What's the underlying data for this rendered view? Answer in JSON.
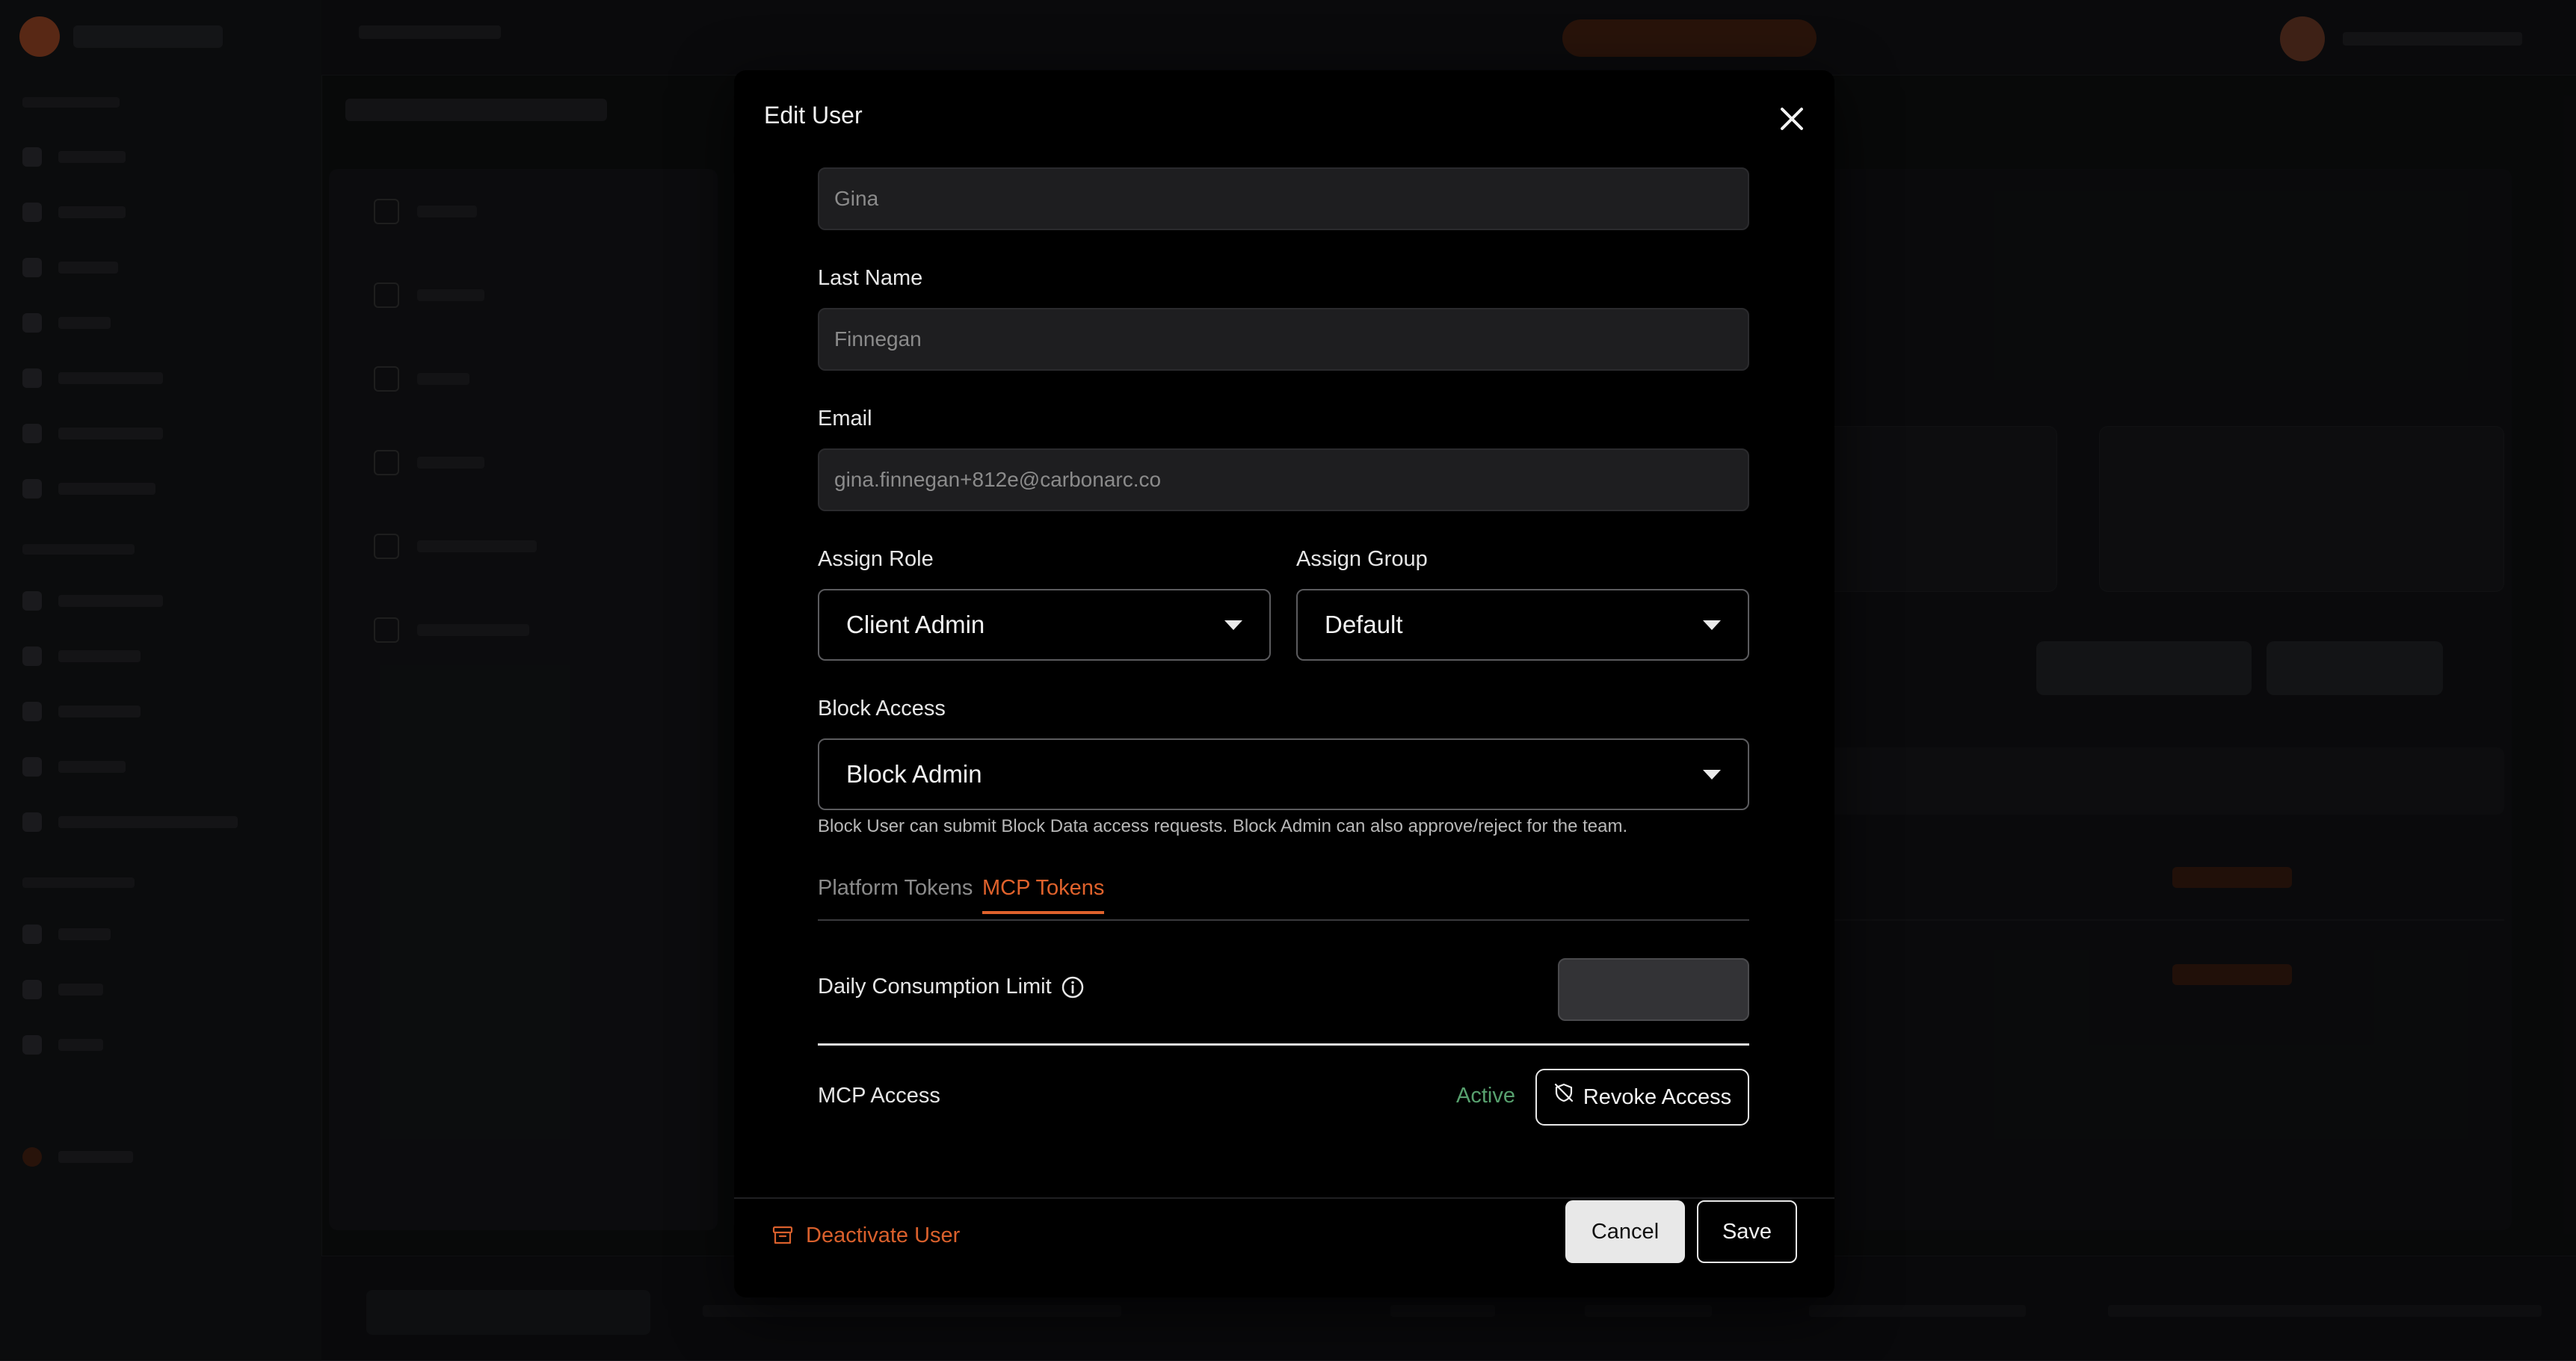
{
  "modal": {
    "title": "Edit User",
    "fields": {
      "first_name_value": "Gina",
      "last_name_label": "Last Name",
      "last_name_value": "Finnegan",
      "email_label": "Email",
      "email_value": "gina.finnegan+812e@carbonarc.co",
      "assign_role_label": "Assign Role",
      "assign_role_value": "Client Admin",
      "assign_group_label": "Assign Group",
      "assign_group_value": "Default",
      "block_access_label": "Block Access",
      "block_access_value": "Block Admin",
      "block_access_helper": "Block User can submit Block Data access requests. Block Admin can also approve/reject for the team."
    },
    "tabs": [
      {
        "label": "Platform Tokens",
        "active": false
      },
      {
        "label": "MCP Tokens",
        "active": true
      }
    ],
    "mcp": {
      "daily_limit_label": "Daily Consumption Limit",
      "daily_limit_value": "",
      "access_label": "MCP Access",
      "access_status": "Active",
      "revoke_label": "Revoke Access"
    },
    "footer": {
      "deactivate_label": "Deactivate User",
      "cancel_label": "Cancel",
      "save_label": "Save"
    }
  },
  "colors": {
    "accent": "#e0622c",
    "active_status": "#57a06e",
    "modal_bg": "#000000",
    "input_bg": "#1e1e20"
  },
  "icons": {
    "close": "close-icon",
    "caret": "chevron-down-icon",
    "info": "info-icon",
    "revoke": "shield-off-icon",
    "deactivate": "archive-icon"
  }
}
